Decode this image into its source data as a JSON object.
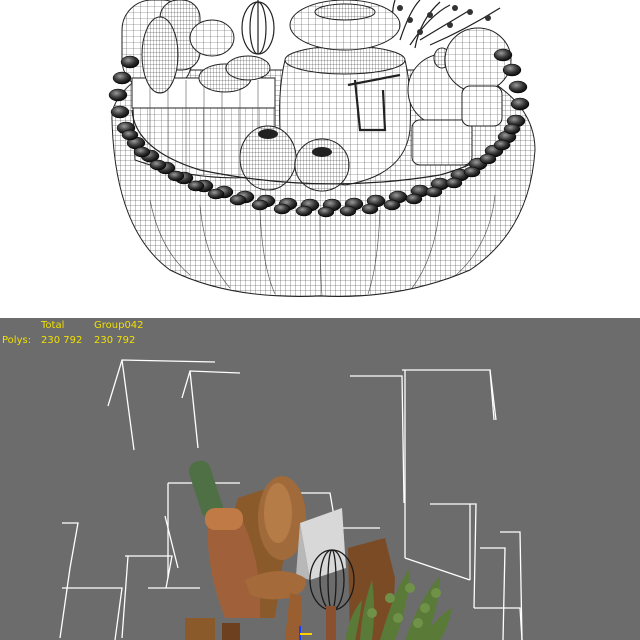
{
  "viewport": {
    "stats": {
      "headers": [
        "Total",
        "Group042"
      ],
      "rows": [
        {
          "label": "Polys:",
          "values": [
            "230 792",
            "230 792"
          ]
        }
      ]
    }
  },
  "colors": {
    "stats_text": "#f0e000",
    "viewport_bg": "#6c6c6c",
    "wire_bg": "#ffffff",
    "bounding_box": "#ffffff"
  }
}
